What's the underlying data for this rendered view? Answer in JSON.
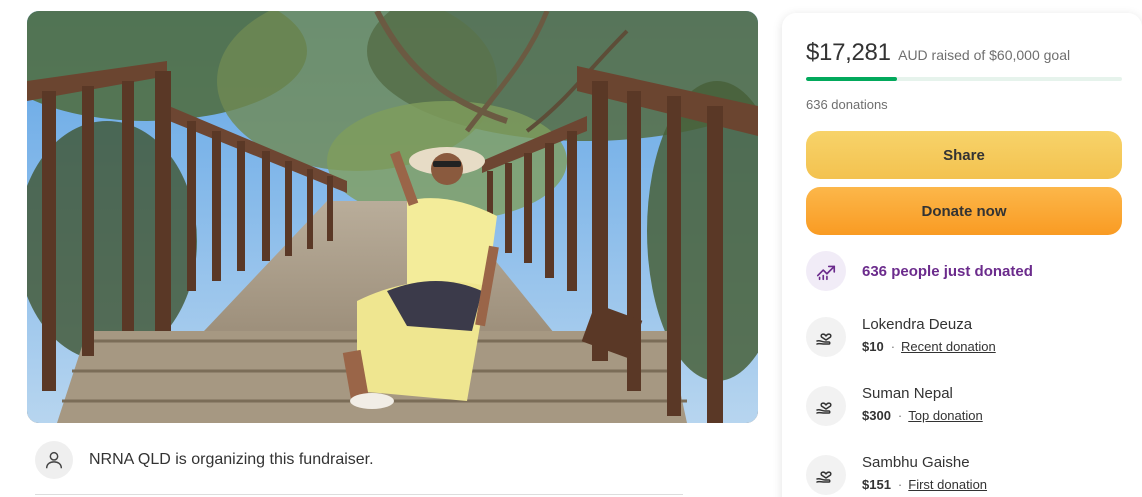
{
  "organizer": {
    "text": "NRNA QLD is organizing this fundraiser.",
    "avatar_icon": "person-icon"
  },
  "fundraiser": {
    "amount_raised": "$17,281",
    "goal_text": "AUD raised of $60,000 goal",
    "progress_fraction": 0.288,
    "progress_color": "#02a95c",
    "donations_count": "636 donations",
    "share_label": "Share",
    "donate_label": "Donate now",
    "recent_activity": "636 people just donated",
    "recent_activity_icon": "trending-up-icon",
    "accent_purple": "#6b2b8c"
  },
  "donors": [
    {
      "name": "Lokendra Deuza",
      "amount": "$10",
      "tag": "Recent donation",
      "icon": "heart-hand-icon"
    },
    {
      "name": "Suman Nepal",
      "amount": "$300",
      "tag": "Top donation",
      "icon": "heart-hand-icon"
    },
    {
      "name": "Sambhu Gaishe",
      "amount": "$151",
      "tag": "First donation",
      "icon": "heart-hand-icon"
    }
  ]
}
